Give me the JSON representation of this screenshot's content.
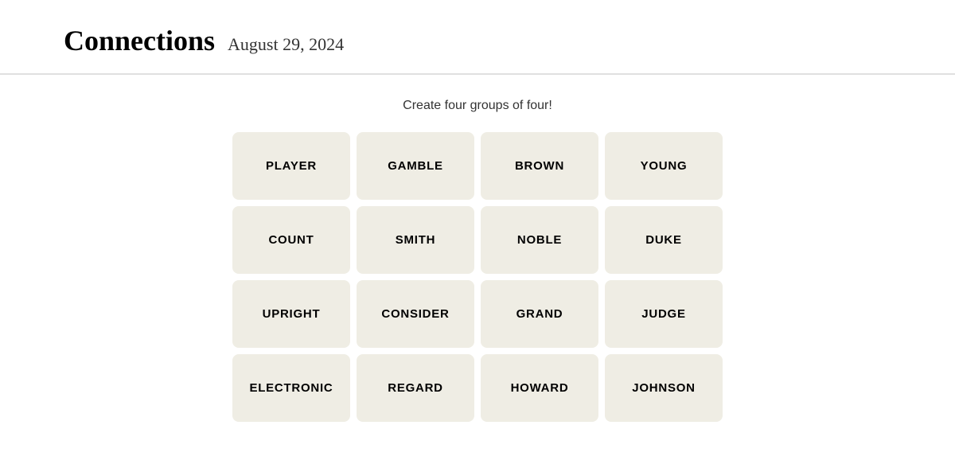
{
  "header": {
    "title": "Connections",
    "date": "August 29, 2024"
  },
  "game": {
    "subtitle": "Create four groups of four!",
    "tiles": [
      {
        "id": "tile-player",
        "label": "PLAYER"
      },
      {
        "id": "tile-gamble",
        "label": "GAMBLE"
      },
      {
        "id": "tile-brown",
        "label": "BROWN"
      },
      {
        "id": "tile-young",
        "label": "YOUNG"
      },
      {
        "id": "tile-count",
        "label": "COUNT"
      },
      {
        "id": "tile-smith",
        "label": "SMITH"
      },
      {
        "id": "tile-noble",
        "label": "NOBLE"
      },
      {
        "id": "tile-duke",
        "label": "DUKE"
      },
      {
        "id": "tile-upright",
        "label": "UPRIGHT"
      },
      {
        "id": "tile-consider",
        "label": "CONSIDER"
      },
      {
        "id": "tile-grand",
        "label": "GRAND"
      },
      {
        "id": "tile-judge",
        "label": "JUDGE"
      },
      {
        "id": "tile-electronic",
        "label": "ELECTRONIC"
      },
      {
        "id": "tile-regard",
        "label": "REGARD"
      },
      {
        "id": "tile-howard",
        "label": "HOWARD"
      },
      {
        "id": "tile-johnson",
        "label": "JOHNSON"
      }
    ]
  }
}
